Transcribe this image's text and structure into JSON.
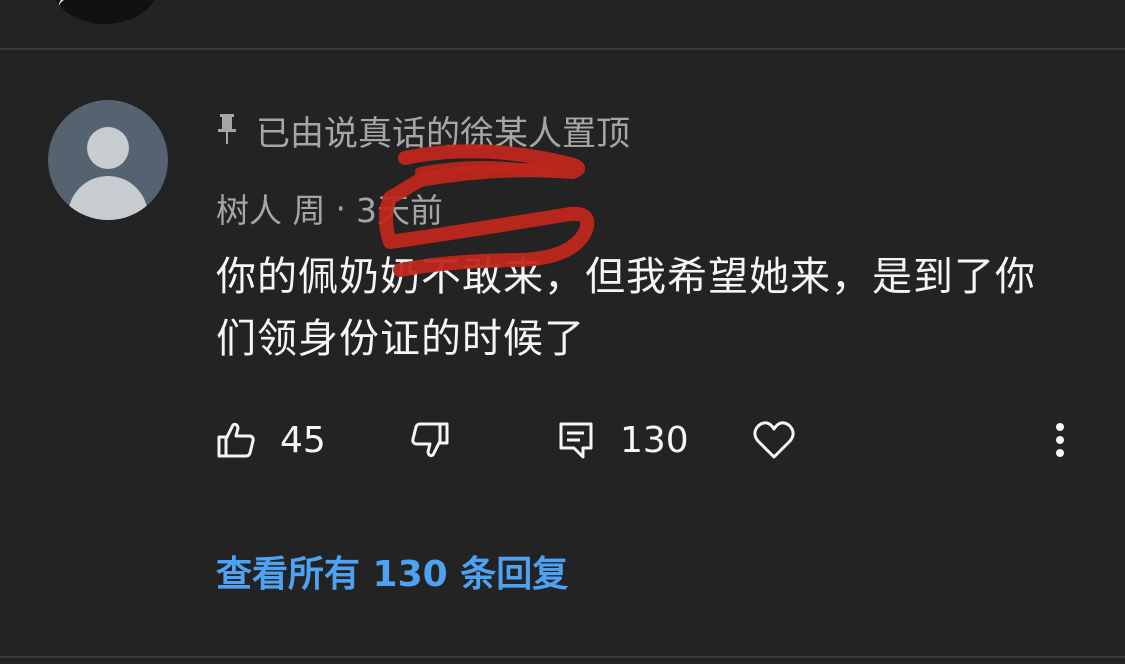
{
  "pinned": {
    "icon": "pin-icon",
    "text": "已由说真话的徐某人置顶"
  },
  "comment": {
    "author": "树人 周",
    "separator": "·",
    "time": "3天前",
    "text": "你的佩奶奶不敢来，但我希望她来，是到了你们领身份证的时候了"
  },
  "actions": {
    "like_icon": "thumbs-up-icon",
    "like_count": "45",
    "dislike_icon": "thumbs-down-icon",
    "reply_icon": "reply-icon",
    "reply_count": "130",
    "heart_icon": "heart-icon",
    "more_icon": "more-vertical-icon"
  },
  "view_replies": "查看所有 130 条回复",
  "colors": {
    "background": "#232323",
    "secondary_text": "#a6a6a6",
    "primary_text": "#f5f5f5",
    "link": "#4ea2f2",
    "annotation": "#c0271c"
  }
}
